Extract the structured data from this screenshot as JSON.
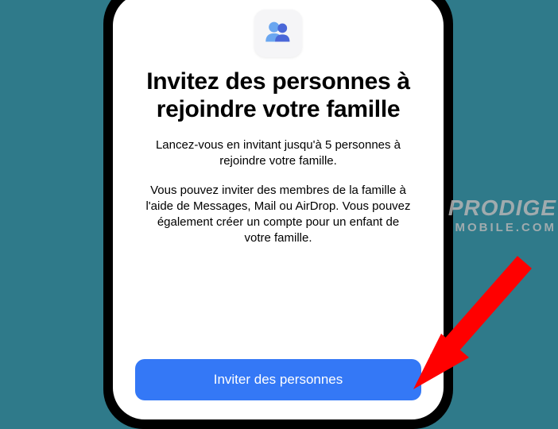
{
  "icon": "family-sharing-icon",
  "title": "Invitez des personnes à rejoindre votre famille",
  "subtitle": "Lancez-vous en invitant jusqu'à 5 personnes à rejoindre votre famille.",
  "description": "Vous pouvez inviter des membres de la famille à l'aide de Messages, Mail ou AirDrop. Vous pouvez également créer un compte pour un enfant de votre famille.",
  "button_label": "Inviter des personnes",
  "watermark": {
    "line1": "PRODIGE",
    "line2": "MOBILE.COM"
  },
  "colors": {
    "background": "#2f7a8a",
    "button": "#3478f6",
    "arrow": "#ff0000"
  }
}
